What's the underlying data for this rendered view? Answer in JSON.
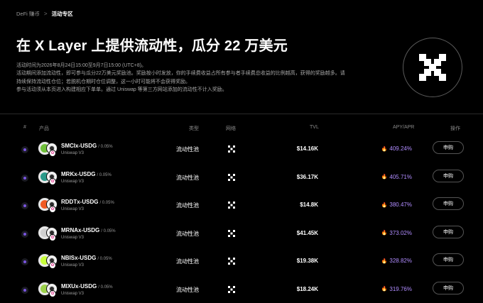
{
  "breadcrumb": {
    "parent": "DeFi 赚币",
    "separator": ">",
    "current": "活动专区"
  },
  "title": "在 X Layer 上提供流动性，瓜分 22 万美元",
  "description": [
    "活动时间为2026年8月24日15:00至9月7日15:00 (UTC+8)。",
    "活动期间添加流动性，即可参与瓜分22万美元奖励池。奖励按小时发放，你的手续费收益占所有参与者手续费总收益的比例越高，获得的奖励越多。请",
    "持续保持流动性仓位；若脱机仓期时仓位调整，这一小时可能将不会获得奖励。",
    "参与活动须从本页进入构建相应下单单。通过 Uniswap 等第三方网站添加的流动性不计入奖励。"
  ],
  "hero_icon": "x-layer-logo-icon",
  "table": {
    "headers": {
      "rank": "#",
      "product": "产品",
      "type": "类型",
      "network": "网络",
      "tvl": "TVL",
      "apy": "APY/APR",
      "action": "操作"
    },
    "rows": [
      {
        "pair": "SMCIx-USDG",
        "fee": "/ 0.05%",
        "protocol": "Uniswap V3",
        "type": "流动性池",
        "tvl": "$14.16K",
        "apy": "409.24%",
        "action": "申购",
        "coin_color": "#6fbf3a"
      },
      {
        "pair": "MRKx-USDG",
        "fee": "/ 0.05%",
        "protocol": "Uniswap V3",
        "type": "流动性池",
        "tvl": "$36.17K",
        "apy": "405.71%",
        "action": "申购",
        "coin_color": "#2b9a8a"
      },
      {
        "pair": "RDDTx-USDG",
        "fee": "/ 0.05%",
        "protocol": "Uniswap V3",
        "type": "流动性池",
        "tvl": "$14.8K",
        "apy": "380.47%",
        "action": "申购",
        "coin_color": "#f05a23"
      },
      {
        "pair": "MRNAx-USDG",
        "fee": "/ 0.05%",
        "protocol": "Uniswap V3",
        "type": "流动性池",
        "tvl": "$41.45K",
        "apy": "373.02%",
        "action": "申购",
        "coin_color": "#d0d0d0"
      },
      {
        "pair": "NBISx-USDG",
        "fee": "/ 0.05%",
        "protocol": "Uniswap V3",
        "type": "流动性池",
        "tvl": "$19.38K",
        "apy": "328.82%",
        "action": "申购",
        "coin_color": "#c8ff3a"
      },
      {
        "pair": "MIXUx-USDG",
        "fee": "/ 0.05%",
        "protocol": "Uniswap V3",
        "type": "流动性池",
        "tvl": "$18.24K",
        "apy": "319.76%",
        "action": "申购",
        "coin_color": "#9bd14a"
      }
    ]
  },
  "colors": {
    "accent_purple": "#b08cff",
    "background": "#000000"
  }
}
